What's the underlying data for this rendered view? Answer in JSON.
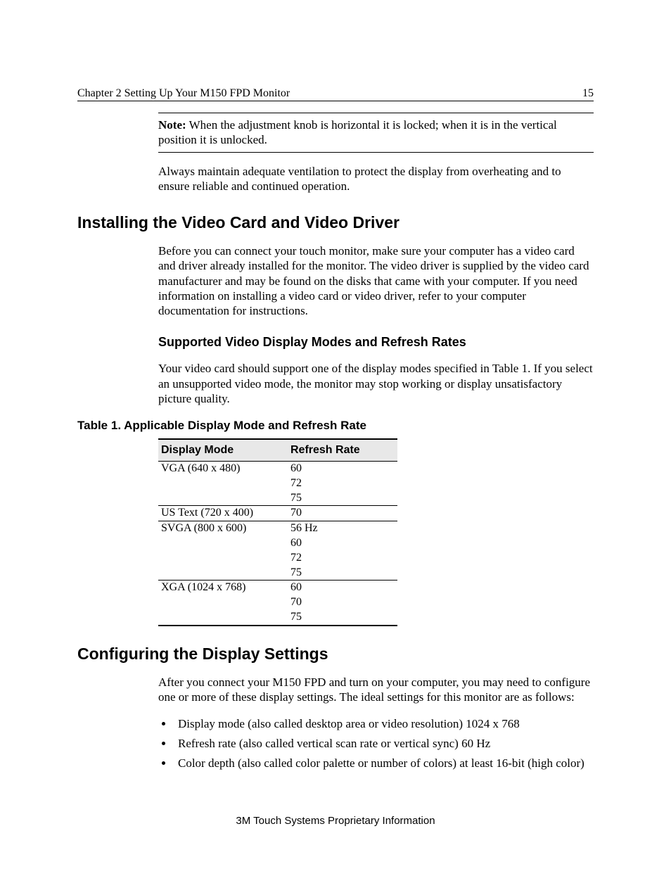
{
  "header": {
    "chapter": "Chapter 2 Setting Up Your M150 FPD Monitor",
    "page_number": "15"
  },
  "note": {
    "label": "Note:",
    "text": "When the adjustment knob is horizontal it is locked; when it is in the vertical position it is unlocked."
  },
  "para_ventilation": "Always maintain adequate ventilation to protect the display from overheating and to ensure reliable and continued operation.",
  "section_install": {
    "title": "Installing the Video Card and Video Driver",
    "body": "Before you can connect your touch monitor, make sure your computer has a video card and driver already installed for the monitor. The video driver is supplied by the video card manufacturer and may be found on the disks that came with your computer. If you need information on installing a video card or video driver, refer to your computer documentation for instructions."
  },
  "subsection_modes": {
    "title": "Supported Video Display Modes and Refresh Rates",
    "body": "Your video card should support one of the display modes specified in Table 1.  If you select an unsupported video mode, the monitor may stop working or display unsatisfactory picture quality."
  },
  "table": {
    "caption": "Table 1.  Applicable Display Mode and Refresh Rate",
    "col1": "Display Mode",
    "col2": "Refresh Rate",
    "rows": [
      {
        "mode": "VGA (640 x 480)",
        "rates": [
          "60",
          "72",
          "75"
        ]
      },
      {
        "mode": "US Text (720 x 400)",
        "rates": [
          "70"
        ]
      },
      {
        "mode": "SVGA (800 x 600)",
        "rates": [
          "56 Hz",
          "60",
          "72",
          "75"
        ]
      },
      {
        "mode": "XGA (1024 x 768)",
        "rates": [
          "60",
          "70",
          "75"
        ]
      }
    ]
  },
  "section_config": {
    "title": "Configuring the Display Settings",
    "body": "After you connect your M150 FPD and turn on your computer, you may need to configure one or more of these display settings. The ideal settings for this monitor are as follows:",
    "bullets": [
      "Display mode (also called desktop area or video resolution) 1024 x 768",
      "Refresh rate (also called vertical scan rate or vertical sync) 60 Hz",
      "Color depth (also called color palette or number of colors) at least 16-bit (high color)"
    ]
  },
  "footer": "3M Touch Systems Proprietary Information"
}
